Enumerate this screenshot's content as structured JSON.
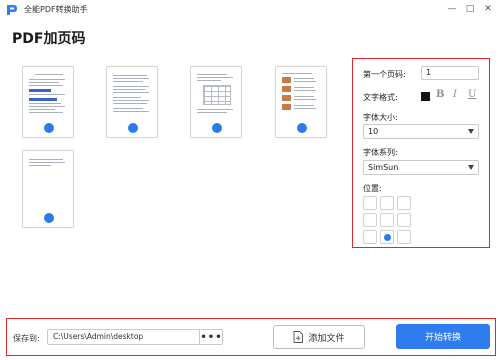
{
  "app": {
    "title": "全能PDF转换助手"
  },
  "window_controls": {
    "minimize": "—",
    "maximize": "□",
    "close": "✕"
  },
  "page_title": "PDF加页码",
  "thumbnails": [
    {
      "id": "page-1"
    },
    {
      "id": "page-2"
    },
    {
      "id": "page-3"
    },
    {
      "id": "page-4"
    },
    {
      "id": "page-5"
    }
  ],
  "panel": {
    "first_page_label": "第一个页码:",
    "first_page_value": "1",
    "text_format_label": "文字格式:",
    "text_color": "#111111",
    "bold_label": "B",
    "italic_label": "I",
    "underline_label": "U",
    "font_size_label": "字体大小:",
    "font_size_value": "10",
    "font_family_label": "字体系列:",
    "font_family_value": "SimSun",
    "position_label": "位置:",
    "position_selected": "bottom-center"
  },
  "bottom": {
    "save_label": "保存到:",
    "save_path": "C:\\Users\\Admin\\desktop",
    "more_label": "•••",
    "add_file_label": "添加文件",
    "start_label": "开始转换"
  },
  "colors": {
    "accent": "#2f7bf0",
    "highlight_border": "#e0272d",
    "dot": "#2a7ce8"
  }
}
